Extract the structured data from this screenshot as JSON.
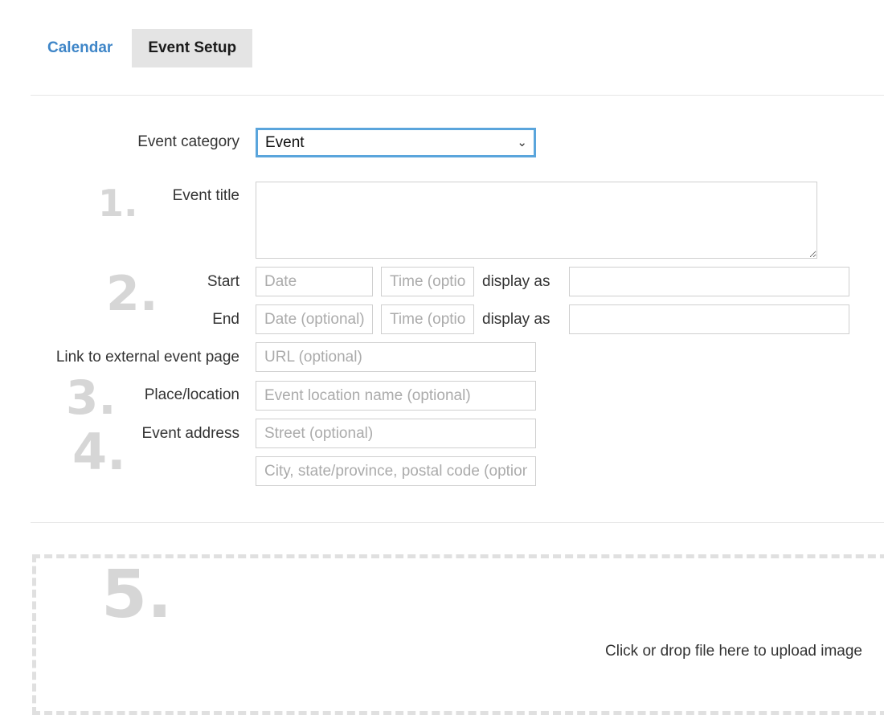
{
  "tabs": [
    {
      "label": "Calendar",
      "active": false
    },
    {
      "label": "Event Setup",
      "active": true
    }
  ],
  "form": {
    "category": {
      "label": "Event category",
      "value": "Event"
    },
    "title": {
      "label": "Event title",
      "value": ""
    },
    "start": {
      "label": "Start",
      "date_placeholder": "Date",
      "time_placeholder": "Time (optional)",
      "display_as_label": "display as",
      "display_value": ""
    },
    "end": {
      "label": "End",
      "date_placeholder": "Date (optional)",
      "time_placeholder": "Time (optional)",
      "display_as_label": "display as",
      "display_value": ""
    },
    "link": {
      "label": "Link to external event page",
      "placeholder": "URL (optional)"
    },
    "place": {
      "label": "Place/location",
      "placeholder": "Event location name (optional)"
    },
    "address": {
      "label": "Event address",
      "street_placeholder": "Street (optional)",
      "city_placeholder": "City, state/province, postal code (optional)"
    }
  },
  "annotations": [
    "1.",
    "2.",
    "3.",
    "4.",
    "5."
  ],
  "upload": {
    "text": "Click or drop file here to upload image"
  },
  "colors": {
    "accent": "#3f86c8",
    "focus_border": "#5aa5dc",
    "active_tab_bg": "#e4e4e4"
  }
}
